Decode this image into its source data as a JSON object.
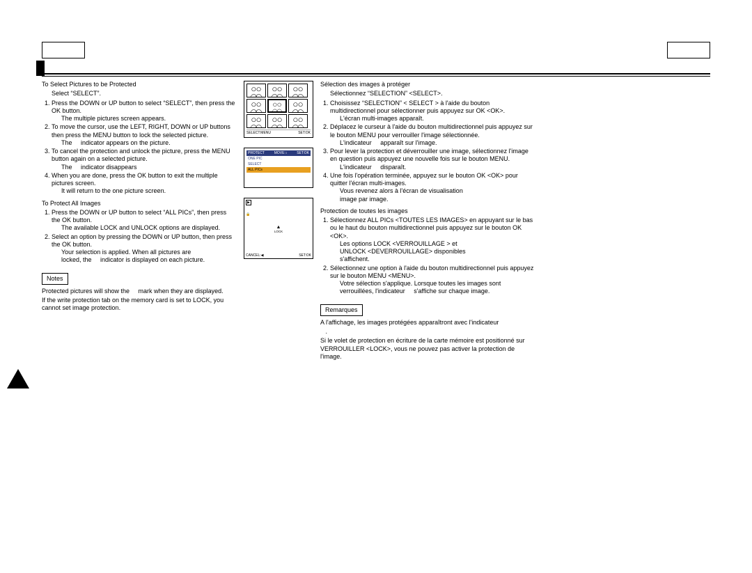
{
  "topLeftBox": "",
  "topRightBox": "",
  "left": {
    "h1": "To Select Pictures to be Protected",
    "h1sub": "Select “SELECT”.",
    "list1": [
      "Press the DOWN or UP button to select “SELECT”, then press the OK button.",
      "To move the cursor, use the LEFT, RIGHT, DOWN or UP buttons then press the MENU button to lock the selected picture.",
      "To cancel the protection and unlock the picture, press the MENU button again on a selected picture.",
      "When you are done, press the OK button to exit the multiple pictures screen."
    ],
    "afterL1a": "The multiple pictures screen appears.",
    "afterL2": "The     indicator appears on the picture.",
    "afterL3": "The     indicator disappears",
    "afterL4": "It will return to the one picture screen.",
    "h2": "To Protect All Images",
    "list2": [
      "Press the DOWN or UP button to select “ALL PICs”, then press the OK button.",
      "Select an option by pressing the DOWN or UP button, then press the OK button."
    ],
    "afterL2_1": "The available LOCK and UNLOCK options are displayed.",
    "afterL2_2a": "Your selection is applied. When all pictures are",
    "afterL2_2b": "locked, the     indicator is displayed on each picture.",
    "notesLabel": "Notes",
    "note1": "Protected pictures will show the     mark when they are displayed.",
    "note2": "If the write protection tab on the memory card is set to LOCK, you cannot set image protection."
  },
  "mid": {
    "d1_footerL": "SELECT:MENU",
    "d1_footerR": "SET:OK",
    "d2_header": "PROTECT",
    "d2_headerMid": "MOVE:↕",
    "d2_headerR": "SET:OK",
    "d2_items": [
      "ONE PIC",
      "SELECT",
      "ALL PICs"
    ],
    "d3_play": "▶",
    "d3_lockTop": "▲",
    "d3_lockLabel": "LOCK",
    "d3_footerL": "CANCEL:◀",
    "d3_footerR": "SET:OK"
  },
  "right": {
    "h1": "Sélection des images à protéger",
    "h1sub": "Sélectionnez “SELECTION” <SELECT>.",
    "list1": [
      "Choisissez “SELECTION” < SELECT > à l'aide du bouton multidirectionnel pour sélectionner puis appuyez sur OK <OK>.",
      "Déplacez le curseur à l'aide du bouton multidirectionnel puis appuyez sur le bouton MENU pour verrouiller l'image sélectionnée.",
      "Pour lever la protection et déverrouiller une image, sélectionnez l'image en question puis appuyez une nouvelle fois sur le bouton MENU.",
      "Une fois l'opération terminée, appuyez sur le bouton OK <OK> pour quitter l'écran multi-images."
    ],
    "afterR1": "L'écran multi-images apparaît.",
    "afterR2": "L'indicateur     apparaît sur l'image.",
    "afterR3": "L'indicateur     disparaît.",
    "afterR4a": "Vous revenez alors à l'écran de visualisation",
    "afterR4b": "image par image.",
    "h2": "Protection de toutes les images",
    "list2": [
      "Sélectionnez ALL PICs <TOUTES LES IMAGES> en appuyant sur le bas ou le haut du bouton multidirectionnel puis appuyez sur le bouton OK <OK>.",
      "Sélectionnez une option à l'aide du bouton multidirectionnel puis appuyez sur le bouton MENU <MENU>."
    ],
    "afterR2_1a": "Les options LOCK <VERROUILLAGE > et",
    "afterR2_1b": "UNLOCK <DEVERROUILLAGE> disponibles",
    "afterR2_1c": "s'affichent.",
    "afterR2_2a": "Votre sélection s'applique. Lorsque toutes les images sont",
    "afterR2_2b": "verrouillées, l'indicateur     s'affiche sur chaque image.",
    "notesLabel": "Remarques",
    "note1a": "A l'affichage, les images protégées apparaîtront avec l'indicateur",
    "note1b": "   .",
    "note2": "Si le volet de protection en écriture de la carte mémoire est positionné sur VERROUILLER <LOCK>, vous ne pouvez pas activer la protection de l'image."
  }
}
